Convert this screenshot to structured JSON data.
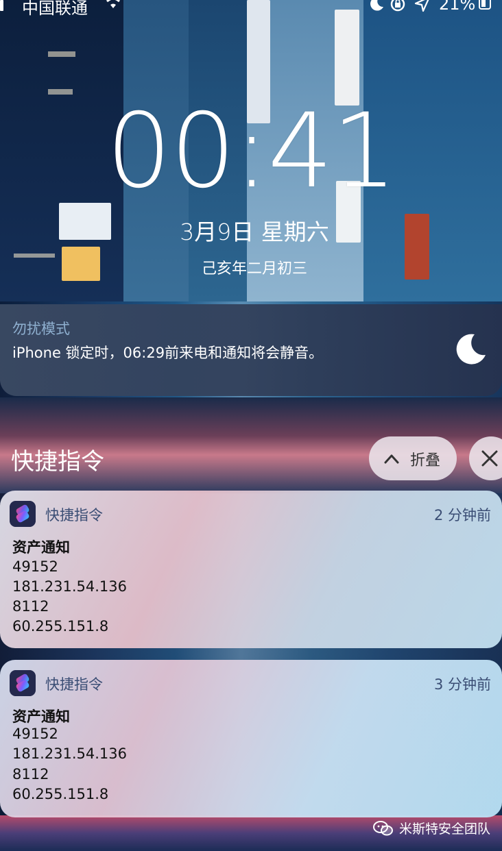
{
  "status_bar": {
    "carrier": "中国联通",
    "battery_percent": "21%"
  },
  "lock_screen": {
    "time": "00:41",
    "date": "3月9日 星期六",
    "lunar_date": "己亥年二月初三"
  },
  "dnd_banner": {
    "title": "勿扰模式",
    "message": "iPhone 锁定时，06:29前来电和通知将会静音。"
  },
  "notification_group": {
    "title": "快捷指令",
    "collapse_label": "折叠"
  },
  "notifications": [
    {
      "app_name": "快捷指令",
      "time": "2 分钟前",
      "title": "资产通知",
      "lines": [
        "49152",
        "181.231.54.136",
        "8112",
        "60.255.151.8"
      ]
    },
    {
      "app_name": "快捷指令",
      "time": "3 分钟前",
      "title": "资产通知",
      "lines": [
        "49152",
        "181.231.54.136",
        "8112",
        "60.255.151.8"
      ]
    }
  ],
  "watermark": {
    "text": "米斯特安全团队"
  },
  "colors": {
    "dnd_title": "#8fb0d0",
    "card_secondary_text": "#3a4d74",
    "shortcuts_icon_gradient": [
      "#ff4d8d",
      "#7b5cff",
      "#2fd0ff"
    ]
  }
}
